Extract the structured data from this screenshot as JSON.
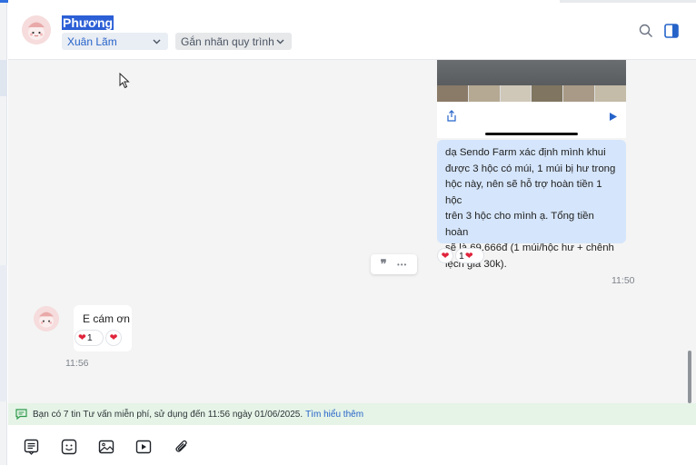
{
  "header": {
    "contact_name": "Phương",
    "assignee": "Xuân Lãm",
    "workflow_label": "Gắn nhãn quy trình",
    "icons": [
      "search-icon",
      "panel-toggle-icon"
    ]
  },
  "conversation": {
    "outgoing_message": {
      "lines": [
        "dạ Sendo Farm xác định mình khui",
        "được 3 hộc có múi, 1 múi bị hư trong",
        "hộc này, nên sẽ hỗ trợ hoàn tiền 1 hộc",
        "trên 3 hộc cho mình ạ. Tổng tiền hoàn",
        "sẽ là 69.666đ (1 múi/hộc hư + chênh",
        "lệch giá 30k)."
      ],
      "reactions": [
        {
          "emoji": "❤",
          "count": ""
        },
        {
          "emoji": "❤",
          "count": "1"
        }
      ],
      "time": "11:50"
    },
    "message_tools": {
      "quote": "❞",
      "more": "•••"
    },
    "incoming_message": {
      "text": "E cám ơn",
      "reactions": [
        {
          "emoji": "❤",
          "count": "1"
        },
        {
          "emoji": "❤",
          "count": ""
        }
      ],
      "time": "11:56"
    }
  },
  "notice": {
    "text": "Bạn có 7 tin Tư vấn miễn phí, sử dụng đến 11:56 ngày 01/06/2025.",
    "link": "Tìm hiểu thêm"
  },
  "toolbar": {
    "icons": [
      "template-icon",
      "sticker-icon",
      "image-icon",
      "video-icon",
      "attachment-icon"
    ]
  },
  "colors": {
    "accent": "#2563c9",
    "outgoing_bubble": "#d5e5fb",
    "notice_bg": "#e5f4e7",
    "heart": "#e0243b"
  }
}
